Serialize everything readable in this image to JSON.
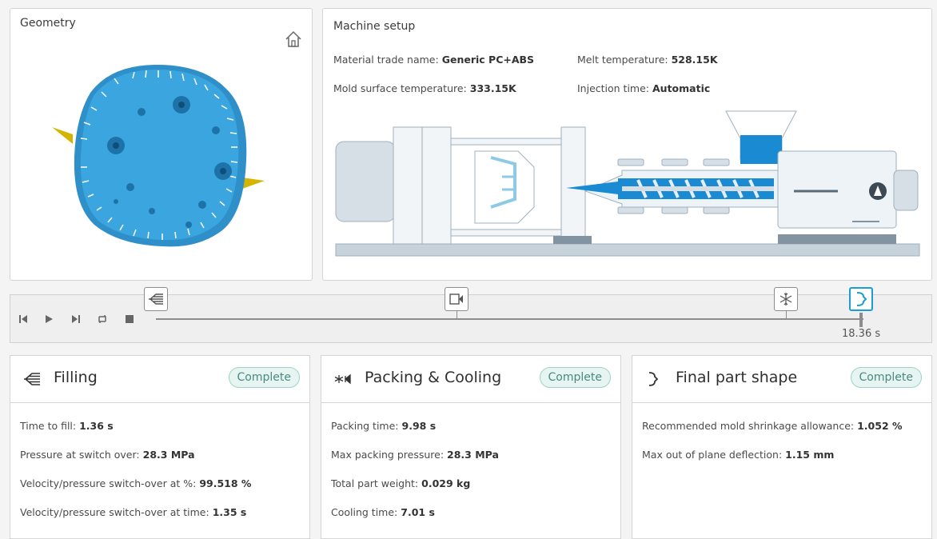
{
  "geometry": {
    "title": "Geometry",
    "home_icon": "home-icon"
  },
  "machine": {
    "title": "Machine setup",
    "material_label": "Material trade name:",
    "material_value": "Generic PC+ABS",
    "melt_label": "Melt temperature:",
    "melt_value": "528.15K",
    "mold_label": "Mold surface temperature:",
    "mold_value": "333.15K",
    "injection_label": "Injection time:",
    "injection_value": "Automatic"
  },
  "timeline": {
    "time": "18.36 s",
    "controls": [
      "skip-back-icon",
      "play-icon",
      "skip-forward-icon",
      "loop-icon",
      "stop-icon"
    ],
    "nodes": [
      "filling-icon",
      "packing-icon",
      "cooling-icon",
      "final-shape-icon"
    ]
  },
  "cards": {
    "filling": {
      "title": "Filling",
      "status": "Complete",
      "rows": [
        {
          "label": "Time to fill:",
          "value": "1.36 s"
        },
        {
          "label": "Pressure at switch over:",
          "value": "28.3 MPa"
        },
        {
          "label": "Velocity/pressure switch-over at %:",
          "value": "99.518 %"
        },
        {
          "label": "Velocity/pressure switch-over at time:",
          "value": "1.35 s"
        }
      ]
    },
    "packing": {
      "title": "Packing & Cooling",
      "status": "Complete",
      "rows": [
        {
          "label": "Packing time:",
          "value": "9.98 s"
        },
        {
          "label": "Max packing pressure:",
          "value": "28.3 MPa"
        },
        {
          "label": "Total part weight:",
          "value": "0.029 kg"
        },
        {
          "label": "Cooling time:",
          "value": "7.01 s"
        }
      ]
    },
    "final": {
      "title": "Final part shape",
      "status": "Complete",
      "rows": [
        {
          "label": "Recommended mold shrinkage allowance:",
          "value": "1.052 %"
        },
        {
          "label": "Max out of plane deflection:",
          "value": "1.15 mm"
        }
      ]
    }
  },
  "colors": {
    "part_blue": "#3aa0d8",
    "accent": "#1a9ed8",
    "badge_border": "#9fd3c6"
  }
}
